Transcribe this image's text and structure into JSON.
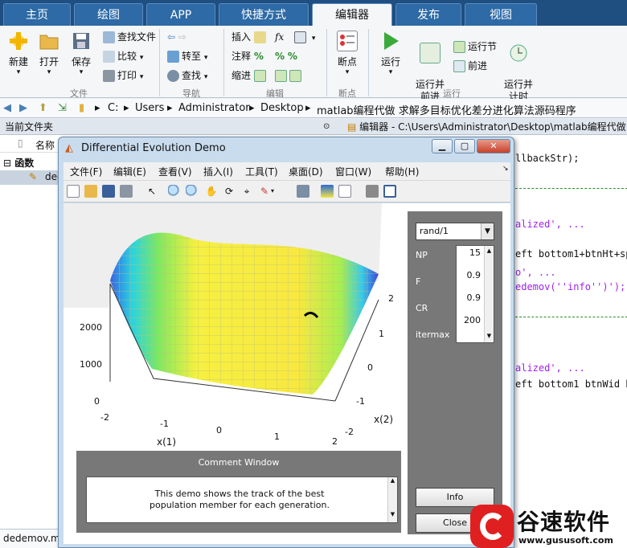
{
  "tabs": [
    "主页",
    "绘图",
    "APP",
    "快捷方式",
    "编辑器",
    "发布",
    "视图"
  ],
  "ribbon": {
    "new": "新建",
    "open": "打开",
    "save": "保存",
    "find_files": "查找文件",
    "compare": "比较",
    "print": "打印",
    "sec_file": "文件",
    "goto": "转至",
    "find": "查找",
    "sec_nav": "导航",
    "insert": "插入",
    "comment": "注释",
    "indent": "缩进",
    "fx": "fx",
    "sec_edit": "编辑",
    "breakpoints": "断点",
    "sec_break": "断点",
    "run": "运行",
    "run_advance": "运行并\n前进",
    "run_section": "运行节",
    "advance": "前进",
    "run_time": "运行并\n计时",
    "sec_run": "运行"
  },
  "address": {
    "parts": [
      "C:",
      "Users",
      "Administrator",
      "Desktop",
      "matlab编程代做 求解多目标优化差分进化算法源码程序"
    ]
  },
  "left_panel": {
    "title": "当前文件夹",
    "col_name": "名称",
    "group": "函数",
    "item": "dedemov.m",
    "status": "dedemov.m"
  },
  "editor": {
    "title": "编辑器 - C:\\Users\\Administrator\\Desktop\\matlab编程代做",
    "lines": [
      "llbackStr);",
      "",
      "alized', ...",
      "eft bottom1+btnHt+sp",
      "o', ...",
      "edemov(''info'')');",
      "",
      "alized', ...",
      "eft bottom1 btnWid b"
    ]
  },
  "figure": {
    "title": "Differential Evolution Demo",
    "menus": [
      "文件(F)",
      "编辑(E)",
      "查看(V)",
      "插入(I)",
      "工具(T)",
      "桌面(D)",
      "窗口(W)",
      "帮助(H)"
    ],
    "strategy": "rand/1",
    "params": [
      {
        "label": "NP",
        "value": "15"
      },
      {
        "label": "F",
        "value": "0.9"
      },
      {
        "label": "CR",
        "value": "0.9"
      },
      {
        "label": "itermax",
        "value": "200"
      }
    ],
    "info_btn": "Info",
    "close_btn": "Close",
    "comment_title": "Comment Window",
    "comment_text": "This demo shows the track of the best population member for each generation.",
    "xlabel": "x(1)",
    "ylabel": "x(2)",
    "zticks": [
      "2000",
      "1000",
      "0"
    ],
    "xticks": [
      "-2",
      "-1",
      "0",
      "1",
      "2"
    ],
    "yticks": [
      "2",
      "1",
      "0",
      "-1",
      "-2"
    ]
  },
  "watermark": {
    "brand": "谷速软件",
    "url": "www.gususoft.com"
  }
}
